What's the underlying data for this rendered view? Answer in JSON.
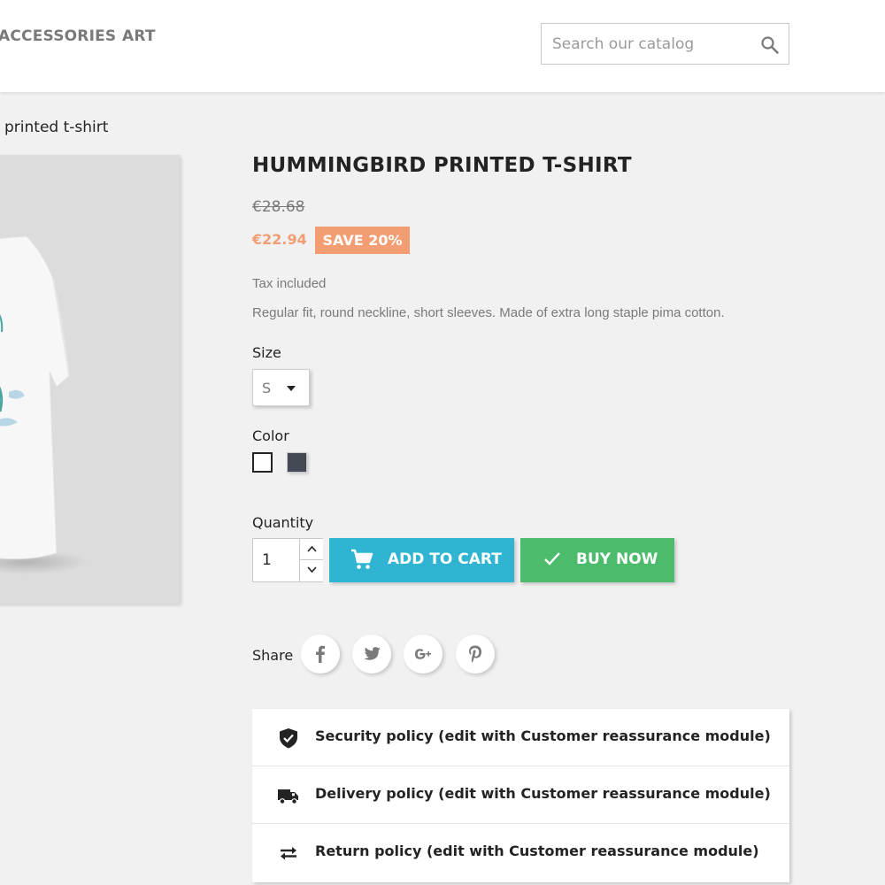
{
  "nav": {
    "items": [
      {
        "label": "ACCESSORIES"
      },
      {
        "label": "ART"
      }
    ]
  },
  "search": {
    "placeholder": "Search our catalog",
    "icon": "search-icon"
  },
  "breadcrumb": {
    "current": "printed t-shirt"
  },
  "product": {
    "title": "HUMMINGBIRD PRINTED T-SHIRT",
    "regular_price": "€28.68",
    "price": "€22.94",
    "discount": "SAVE 20%",
    "tax_label": "Tax included",
    "short_description": "Regular fit, round neckline, short sleeves. Made of extra long staple pima cotton.",
    "size_label": "Size",
    "size_selected": "S",
    "color_label": "Color",
    "colors": [
      {
        "name": "White",
        "hex": "#ffffff",
        "selected": true
      },
      {
        "name": "Black",
        "hex": "#434a54",
        "selected": false
      }
    ],
    "quantity_label": "Quantity",
    "quantity": "1"
  },
  "actions": {
    "add_to_cart": "ADD TO CART",
    "buy_now": "BUY NOW"
  },
  "share": {
    "label": "Share",
    "networks": [
      "facebook",
      "twitter",
      "google-plus",
      "pinterest"
    ]
  },
  "reassurance": [
    {
      "icon": "shield-check-icon",
      "text": "Security policy (edit with Customer reassurance module)"
    },
    {
      "icon": "truck-icon",
      "text": "Delivery policy (edit with Customer reassurance module)"
    },
    {
      "icon": "swap-arrows-icon",
      "text": "Return policy (edit with Customer reassurance module)"
    }
  ],
  "colors": {
    "accent": "#2fb5d2",
    "buy": "#4cbb6c",
    "discount": "#f39d72"
  }
}
